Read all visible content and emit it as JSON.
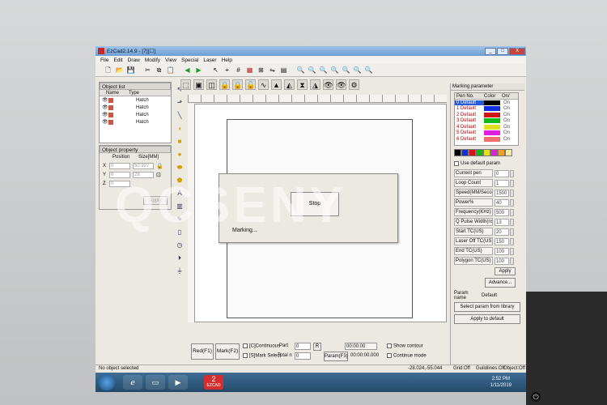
{
  "window": {
    "title": "EzCad2.14.9 - [7][☐]",
    "minimize": "_",
    "maximize": "□",
    "close": "X"
  },
  "menu": [
    "File",
    "Edit",
    "Draw",
    "Modify",
    "View",
    "Special",
    "Laser",
    "Help"
  ],
  "object_list": {
    "title": "Object list",
    "col_name": "Name",
    "col_type": "Type",
    "rows": [
      "Hatch",
      "Hatch",
      "Hatch",
      "Hatch"
    ]
  },
  "object_property": {
    "title": "Object property",
    "col_position": "Position",
    "col_size": "Size[MM]",
    "x_label": "X",
    "y_label": "Y",
    "z_label": "Z",
    "x_pos": "0",
    "x_size": "50.927",
    "y_pos": "0",
    "y_size": "28",
    "z_pos": "0",
    "apply": "Apply"
  },
  "dialog": {
    "stop": "Stop",
    "message": "Marking..."
  },
  "bottom": {
    "red": "Red(F1)",
    "mark": "Mark(F2)",
    "continuous": "[C]Continuous",
    "mark_select": "[S]Mark Select",
    "part_label": "Part",
    "part_value": "0",
    "total_label": "Total n",
    "total_value": "0",
    "r_button": "R",
    "time1": "00:00:00",
    "time2": "00:00:00.000",
    "param": "Param(F3)",
    "show_contour": "Show contour",
    "continue_mode": "Continue mode"
  },
  "marking_param": {
    "title": "Marking parameter",
    "col_pen": "Pen No.",
    "col_color": "Color",
    "col_on": "On/",
    "pens": [
      {
        "name": "0 Default",
        "color": "#000000",
        "on": "On"
      },
      {
        "name": "1 Default",
        "color": "#1030e0",
        "on": "On"
      },
      {
        "name": "2 Default",
        "color": "#d01515",
        "on": "On"
      },
      {
        "name": "3 Default",
        "color": "#12b812",
        "on": "On"
      },
      {
        "name": "4 Default",
        "color": "#e0e020",
        "on": "On"
      },
      {
        "name": "5 Default",
        "color": "#e020e0",
        "on": "On"
      },
      {
        "name": "6 Default",
        "color": "#f07070",
        "on": "On"
      }
    ],
    "palette": [
      "#000000",
      "#1030e0",
      "#d01515",
      "#12b812",
      "#e0e020",
      "#e020e0",
      "#e8a030",
      "#f8e8a0"
    ],
    "use_default": "Use default param",
    "params": [
      {
        "label": "Current pen",
        "value": "0"
      },
      {
        "label": "Loop Count",
        "value": "1"
      },
      {
        "label": "Speed(MM/Secon",
        "value": "1500"
      },
      {
        "label": "Power%",
        "value": "40"
      },
      {
        "label": "Frequency(KHz)",
        "value": "500"
      },
      {
        "label": "Q Pulse Width(ns)",
        "value": "13"
      },
      {
        "label": "Start TC(US)",
        "value": "20"
      },
      {
        "label": "Laser Off TC(US)",
        "value": "150"
      },
      {
        "label": "End TC(US)",
        "value": "100"
      },
      {
        "label": "Polygon TC(US)",
        "value": "100"
      }
    ],
    "apply": "Apply",
    "advance": "Advance...",
    "param_name_label": "Param name",
    "param_name_value": "Default",
    "select_library": "Select param from library",
    "apply_default": "Apply to default"
  },
  "status": {
    "left": "No object selected",
    "coords": "-28.024,-55.044",
    "grid": "Grid:Off",
    "guidelines": "Guildlines:Off",
    "object": "Object:Off"
  },
  "taskbar": {
    "ezcad": "EZCAD",
    "time": "2:52 PM",
    "date": "1/11/2019"
  },
  "watermark": "QCSENY"
}
